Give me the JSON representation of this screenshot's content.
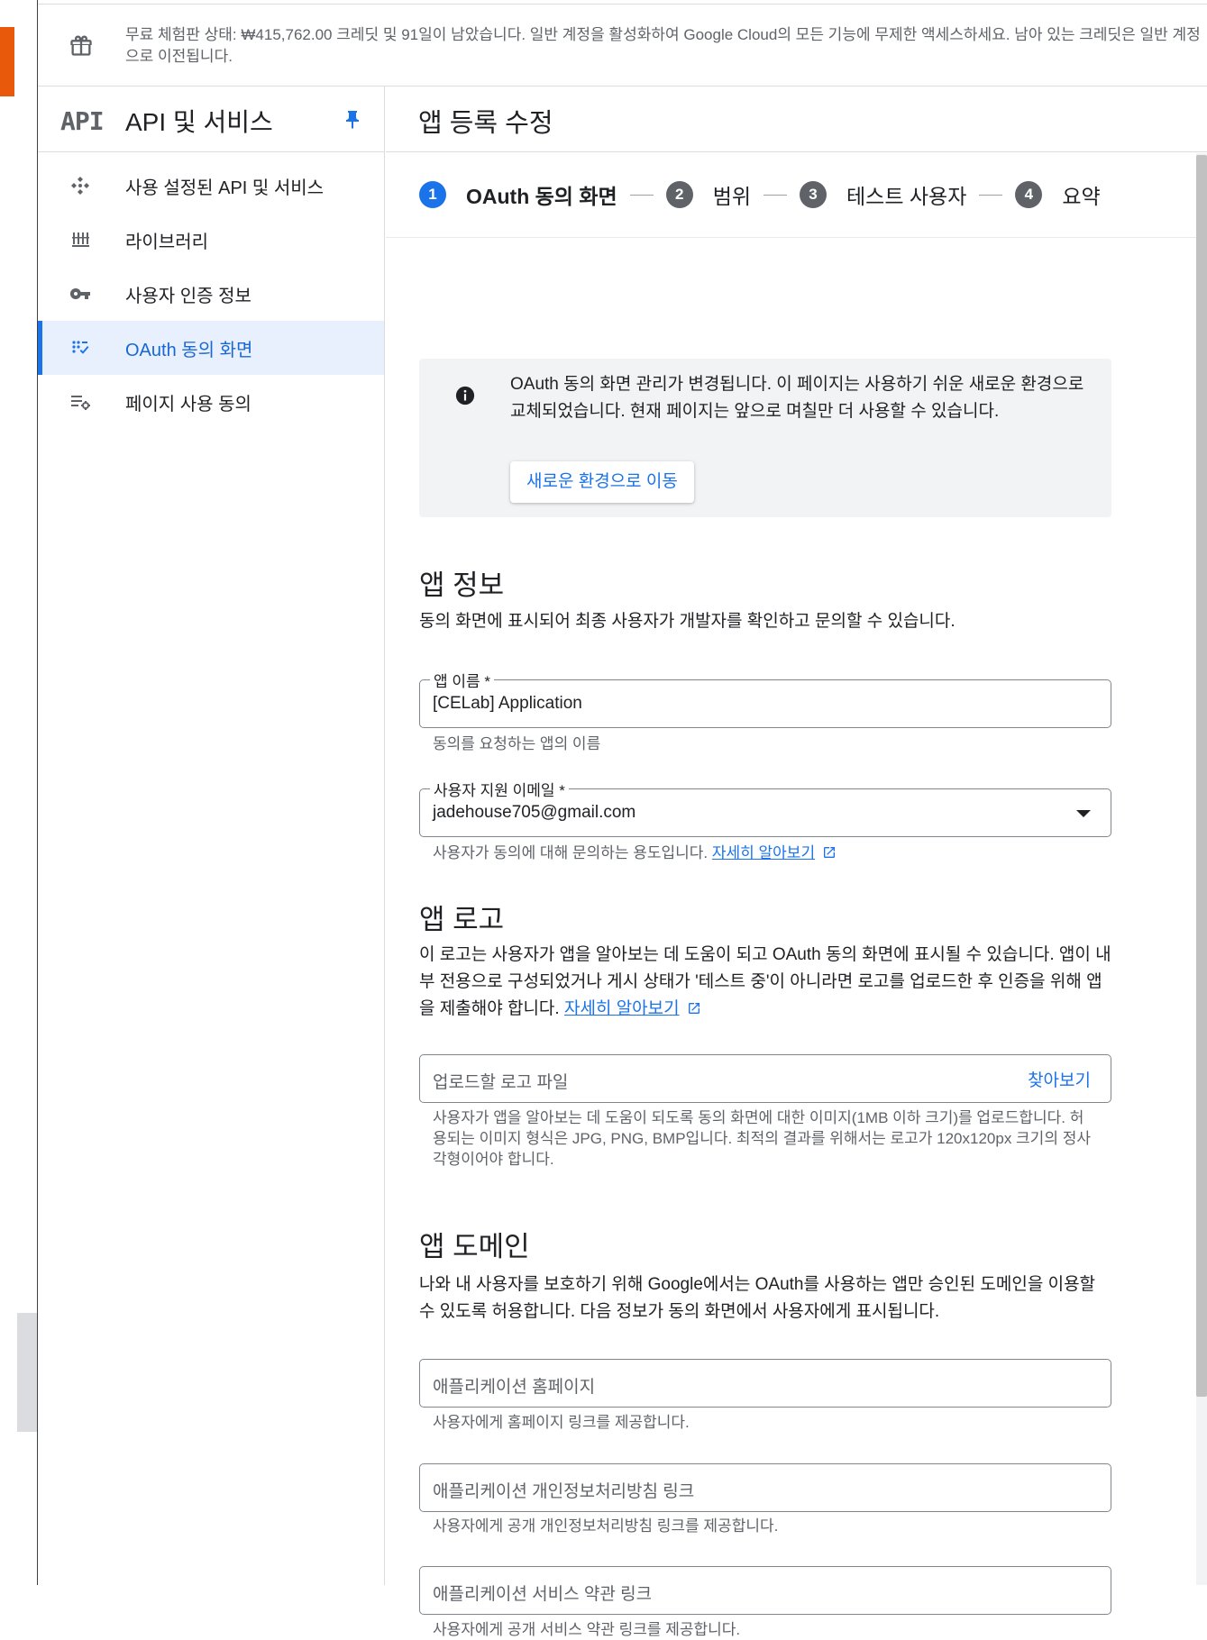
{
  "banner": {
    "text": "무료 체험판 상태: ₩415,762.00 크레딧 및 91일이 남았습니다. 일반 계정을 활성화하여 Google Cloud의 모든 기능에 무제한 액세스하세요. 남아 있는 크레딧은 일반 계정으로 이전됩니다."
  },
  "sidebar": {
    "logo": "API",
    "title": "API 및 서비스",
    "items": [
      {
        "label": "사용 설정된 API 및 서비스",
        "icon": "api-services-icon"
      },
      {
        "label": "라이브러리",
        "icon": "library-icon"
      },
      {
        "label": "사용자 인증 정보",
        "icon": "key-icon"
      },
      {
        "label": "OAuth 동의 화면",
        "icon": "oauth-consent-icon",
        "active": true
      },
      {
        "label": "페이지 사용 동의",
        "icon": "page-usage-settings-icon"
      }
    ]
  },
  "main": {
    "title": "앱 등록 수정",
    "steps": [
      {
        "num": "1",
        "label": "OAuth 동의 화면",
        "active": true
      },
      {
        "num": "2",
        "label": "범위"
      },
      {
        "num": "3",
        "label": "테스트 사용자"
      },
      {
        "num": "4",
        "label": "요약"
      }
    ],
    "info": {
      "text": "OAuth 동의 화면 관리가 변경됩니다. 이 페이지는 사용하기 쉬운 새로운 환경으로 교체되었습니다. 현재 페이지는 앞으로 며칠만 더 사용할 수 있습니다.",
      "button": "새로운 환경으로 이동"
    },
    "app_info": {
      "title": "앱 정보",
      "desc": "동의 화면에 표시되어 최종 사용자가 개발자를 확인하고 문의할 수 있습니다.",
      "app_name_label": "앱 이름 *",
      "app_name_value": "[CELab] Application",
      "app_name_hint": "동의를 요청하는 앱의 이름",
      "email_label": "사용자 지원 이메일 *",
      "email_value": "jadehouse705@gmail.com",
      "email_hint": "사용자가 동의에 대해 문의하는 용도입니다.",
      "learn_more": "자세히 알아보기"
    },
    "app_logo": {
      "title": "앱 로고",
      "desc": "이 로고는 사용자가 앱을 알아보는 데 도움이 되고 OAuth 동의 화면에 표시될 수 있습니다. 앱이 내부 전용으로 구성되었거나 게시 상태가 '테스트 중'이 아니라면 로고를 업로드한 후 인증을 위해 앱을 제출해야 합니다.",
      "learn_more": "자세히 알아보기",
      "upload_placeholder": "업로드할 로고 파일",
      "browse": "찾아보기",
      "hint": "사용자가 앱을 알아보는 데 도움이 되도록 동의 화면에 대한 이미지(1MB 이하 크기)를 업로드합니다. 허용되는 이미지 형식은 JPG, PNG, BMP입니다. 최적의 결과를 위해서는 로고가 120x120px 크기의 정사각형이어야 합니다."
    },
    "app_domain": {
      "title": "앱 도메인",
      "desc": "나와 내 사용자를 보호하기 위해 Google에서는 OAuth를 사용하는 앱만 승인된 도메인을 이용할 수 있도록 허용합니다. 다음 정보가 동의 화면에서 사용자에게 표시됩니다.",
      "homepage_placeholder": "애플리케이션 홈페이지",
      "homepage_hint": "사용자에게 홈페이지 링크를 제공합니다.",
      "privacy_placeholder": "애플리케이션 개인정보처리방침 링크",
      "privacy_hint": "사용자에게 공개 개인정보처리방침 링크를 제공합니다.",
      "tos_placeholder": "애플리케이션 서비스 약관 링크",
      "tos_hint": "사용자에게 공개 서비스 약관 링크를 제공합니다."
    }
  },
  "colors": {
    "accent": "#1a73e8",
    "active_bg": "#e8f0fe",
    "info_bg": "#f1f3f4"
  }
}
